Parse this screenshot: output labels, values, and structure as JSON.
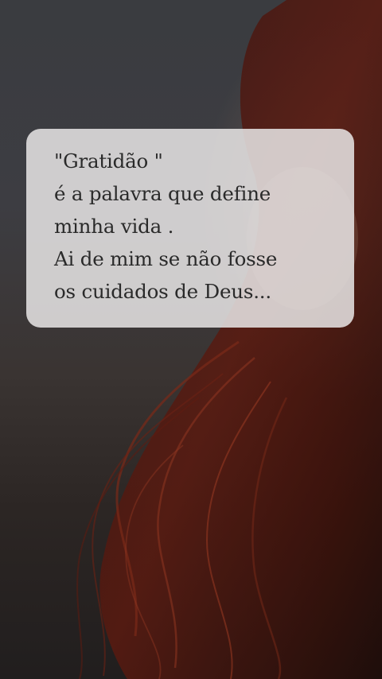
{
  "quote": {
    "lines": [
      "\"Gratidão \"",
      "é a palavra que define",
      "minha vida .",
      "Ai de mim se não fosse",
      "os cuidados de Deus..."
    ]
  },
  "colors": {
    "card_background": "#e8e5e5",
    "text": "#2a2a2a",
    "hair": "#6b1f12",
    "backdrop": "#3a3c40"
  }
}
